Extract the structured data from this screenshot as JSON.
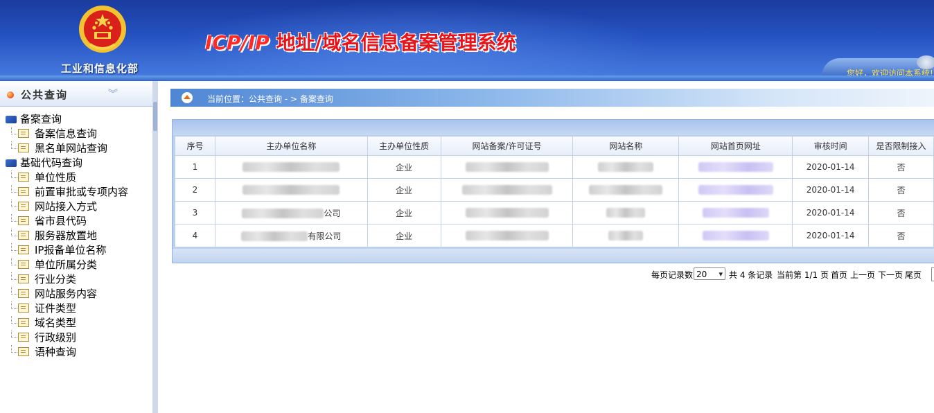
{
  "header": {
    "ministry": "工业和信息化部",
    "title_latin": "ICP/IP",
    "title_han": " 地址/域名信息备案管理系统",
    "welcome": "您好，欢迎访问本系统!"
  },
  "sidebar": {
    "title": "公共查询",
    "collapse_icon": "»",
    "groups": [
      {
        "label": "备案查询",
        "items": [
          "备案信息查询",
          "黑名单网站查询"
        ]
      },
      {
        "label": "基础代码查询",
        "items": [
          "单位性质",
          "前置审批或专项内容",
          "网站接入方式",
          "省市县代码",
          "服务器放置地",
          "IP报备单位名称",
          "单位所属分类",
          "行业分类",
          "网站服务内容",
          "证件类型",
          "域名类型",
          "行政级别",
          "语种查询"
        ]
      }
    ]
  },
  "breadcrumb": {
    "text": "当前位置：公共查询   - >  备案查询"
  },
  "table": {
    "headers": [
      "序号",
      "主办单位名称",
      "主办单位性质",
      "网站备案/许可证号",
      "网站名称",
      "网站首页网址",
      "审核时间",
      "是否限制接入"
    ],
    "rows": [
      {
        "no": "1",
        "org": "",
        "nature": "企业",
        "license": "",
        "site": "",
        "url": "",
        "date": "2020-01-14",
        "restrict": "否"
      },
      {
        "no": "2",
        "org": "",
        "nature": "企业",
        "license": "",
        "site": "",
        "url": "",
        "date": "2020-01-14",
        "restrict": "否"
      },
      {
        "no": "3",
        "org": "公司",
        "nature": "企业",
        "license": "",
        "site": "",
        "url": "",
        "date": "2020-01-14",
        "restrict": "否"
      },
      {
        "no": "4",
        "org": "有限公司",
        "nature": "企业",
        "license": "",
        "site": "",
        "url": "",
        "date": "2020-01-14",
        "restrict": "否"
      }
    ]
  },
  "pager": {
    "per_page_label": "每页记录数",
    "per_page_value": "20",
    "total_text": "共 4 条记录",
    "page_text": "当前第 1/1 页",
    "first": "首页",
    "prev": "上一页",
    "next": "下一页",
    "last": "尾页"
  }
}
